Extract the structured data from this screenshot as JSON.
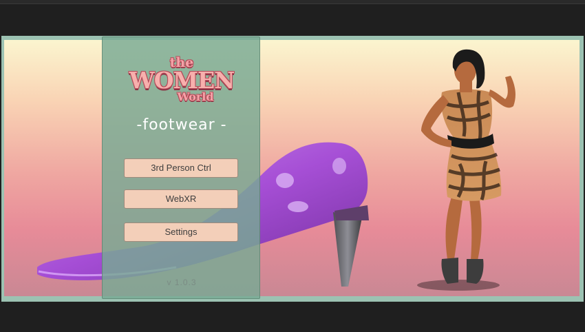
{
  "app": {
    "logo": {
      "line1": "the",
      "line2": "WOMEN",
      "line3": "World"
    },
    "subtitle": "-footwear -",
    "menu": {
      "third_person_label": "3rd Person Ctrl",
      "webxr_label": "WebXR",
      "settings_label": "Settings"
    },
    "version": "v 1.0.3"
  },
  "colors": {
    "panel": "#78aa94",
    "button": "#f3cfb9",
    "logo_pink": "#f7b0ad",
    "shoe_purple": "#a44ad6"
  }
}
